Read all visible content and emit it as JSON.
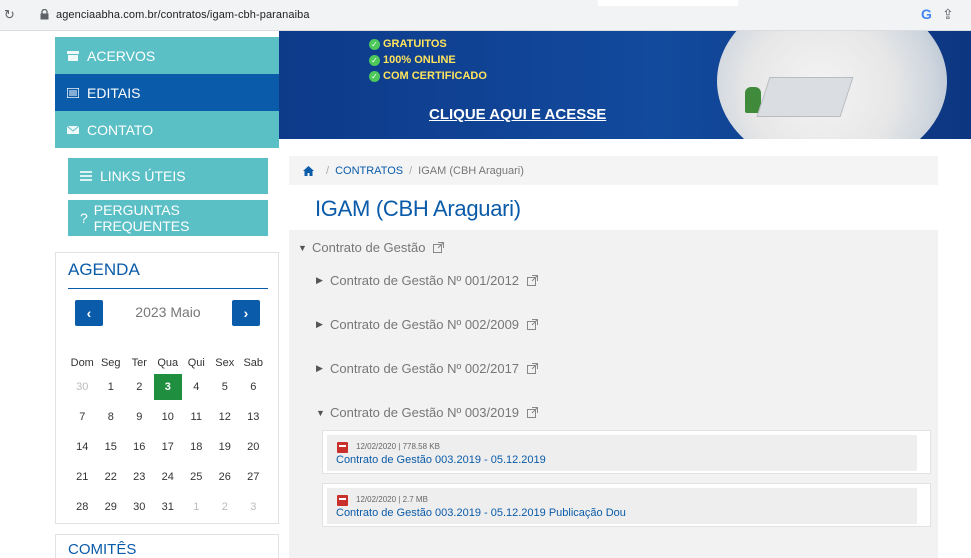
{
  "browser": {
    "url": "agenciaabha.com.br/contratos/igam-cbh-paranaiba"
  },
  "sidebar": {
    "menu": [
      {
        "label": "ACERVOS"
      },
      {
        "label": "EDITAIS"
      },
      {
        "label": "CONTATO"
      }
    ],
    "links_uteis": "LINKS ÚTEIS",
    "perguntas": "PERGUNTAS FREQUENTES",
    "agenda": {
      "title": "AGENDA",
      "month_label": "2023 Maio",
      "weekdays": [
        "Dom",
        "Seg",
        "Ter",
        "Qua",
        "Qui",
        "Sex",
        "Sab"
      ],
      "weeks": [
        [
          "30",
          "1",
          "2",
          "3",
          "4",
          "5",
          "6"
        ],
        [
          "7",
          "8",
          "9",
          "10",
          "11",
          "12",
          "13"
        ],
        [
          "14",
          "15",
          "16",
          "17",
          "18",
          "19",
          "20"
        ],
        [
          "21",
          "22",
          "23",
          "24",
          "25",
          "26",
          "27"
        ],
        [
          "28",
          "29",
          "30",
          "31",
          "1",
          "2",
          "3"
        ]
      ],
      "today": "3"
    },
    "comites_title": "COMITÊS"
  },
  "banner": {
    "features": [
      "GRATUITOS",
      "100% ONLINE",
      "COM CERTIFICADO"
    ],
    "cta": "CLIQUE AQUI E ACESSE"
  },
  "breadcrumb": {
    "link": "CONTRATOS",
    "separator": "/",
    "current": "IGAM (CBH Araguari)"
  },
  "page_title": "IGAM (CBH Araguari)",
  "tree": {
    "root": "Contrato de Gestão",
    "children": [
      {
        "label": "Contrato de Gestão Nº 001/2012",
        "expanded": false
      },
      {
        "label": "Contrato de Gestão Nº 002/2009",
        "expanded": false
      },
      {
        "label": "Contrato de Gestão Nº 002/2017",
        "expanded": false
      },
      {
        "label": "Contrato de Gestão Nº 003/2019",
        "expanded": true
      }
    ],
    "files": [
      {
        "meta": "12/02/2020 | 778.58 KB",
        "name": "Contrato de Gestão 003.2019 - 05.12.2019"
      },
      {
        "meta": "12/02/2020 | 2.7 MB",
        "name": "Contrato de Gestão 003.2019 - 05.12.2019 Publicação Dou"
      }
    ]
  },
  "colors": {
    "teal": "#5bbfc6",
    "blue": "#0a5ba9",
    "today_green": "#1f8f3f",
    "banner_blue": "#124a9d",
    "banner_yellow": "#ffe45c"
  }
}
